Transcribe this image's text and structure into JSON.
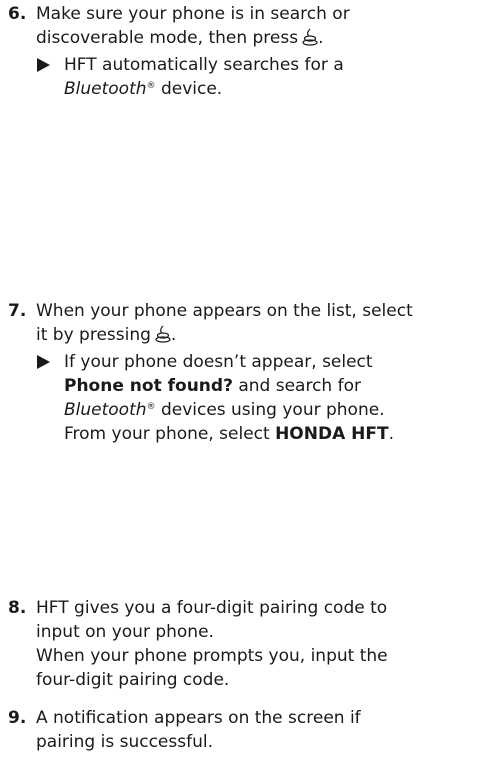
{
  "step6": {
    "number": "6.",
    "line1": "Make sure your phone is in search or",
    "line2_a": "discoverable mode, then press",
    "line2_end": ".",
    "sub_a": "HFT automatically searches for a",
    "sub_bt": "Bluetooth",
    "sub_reg": "®",
    "sub_tail": "device."
  },
  "step7": {
    "number": "7.",
    "line1": "When your phone appears on the list, select",
    "line2_a": "it by pressing",
    "line2_end": ".",
    "sub_l1": "If your phone doesn’t appear, select",
    "sub_l2_bold": "Phone not found?",
    "sub_l2_tail": "and search for",
    "sub_l3_bt": "Bluetooth",
    "sub_l3_reg": "®",
    "sub_l3_tail": "devices using your phone.",
    "sub_l4_a": "From your phone, select",
    "sub_l4_bold": "HONDA HFT",
    "sub_l4_end": "."
  },
  "step8": {
    "number": "8.",
    "line1": "HFT gives you a four-digit pairing code to",
    "line2": "input on your phone.",
    "line3": "When your phone prompts you, input the",
    "line4": "four-digit pairing code."
  },
  "step9": {
    "number": "9.",
    "line1": "A notification appears on the screen if",
    "line2": "pairing is successful."
  },
  "icons": {
    "press_button": "selector-knob-icon",
    "bullet": "triangle-bullet-icon"
  },
  "colors": {
    "text": "#1a1a1a",
    "background": "#ffffff"
  }
}
